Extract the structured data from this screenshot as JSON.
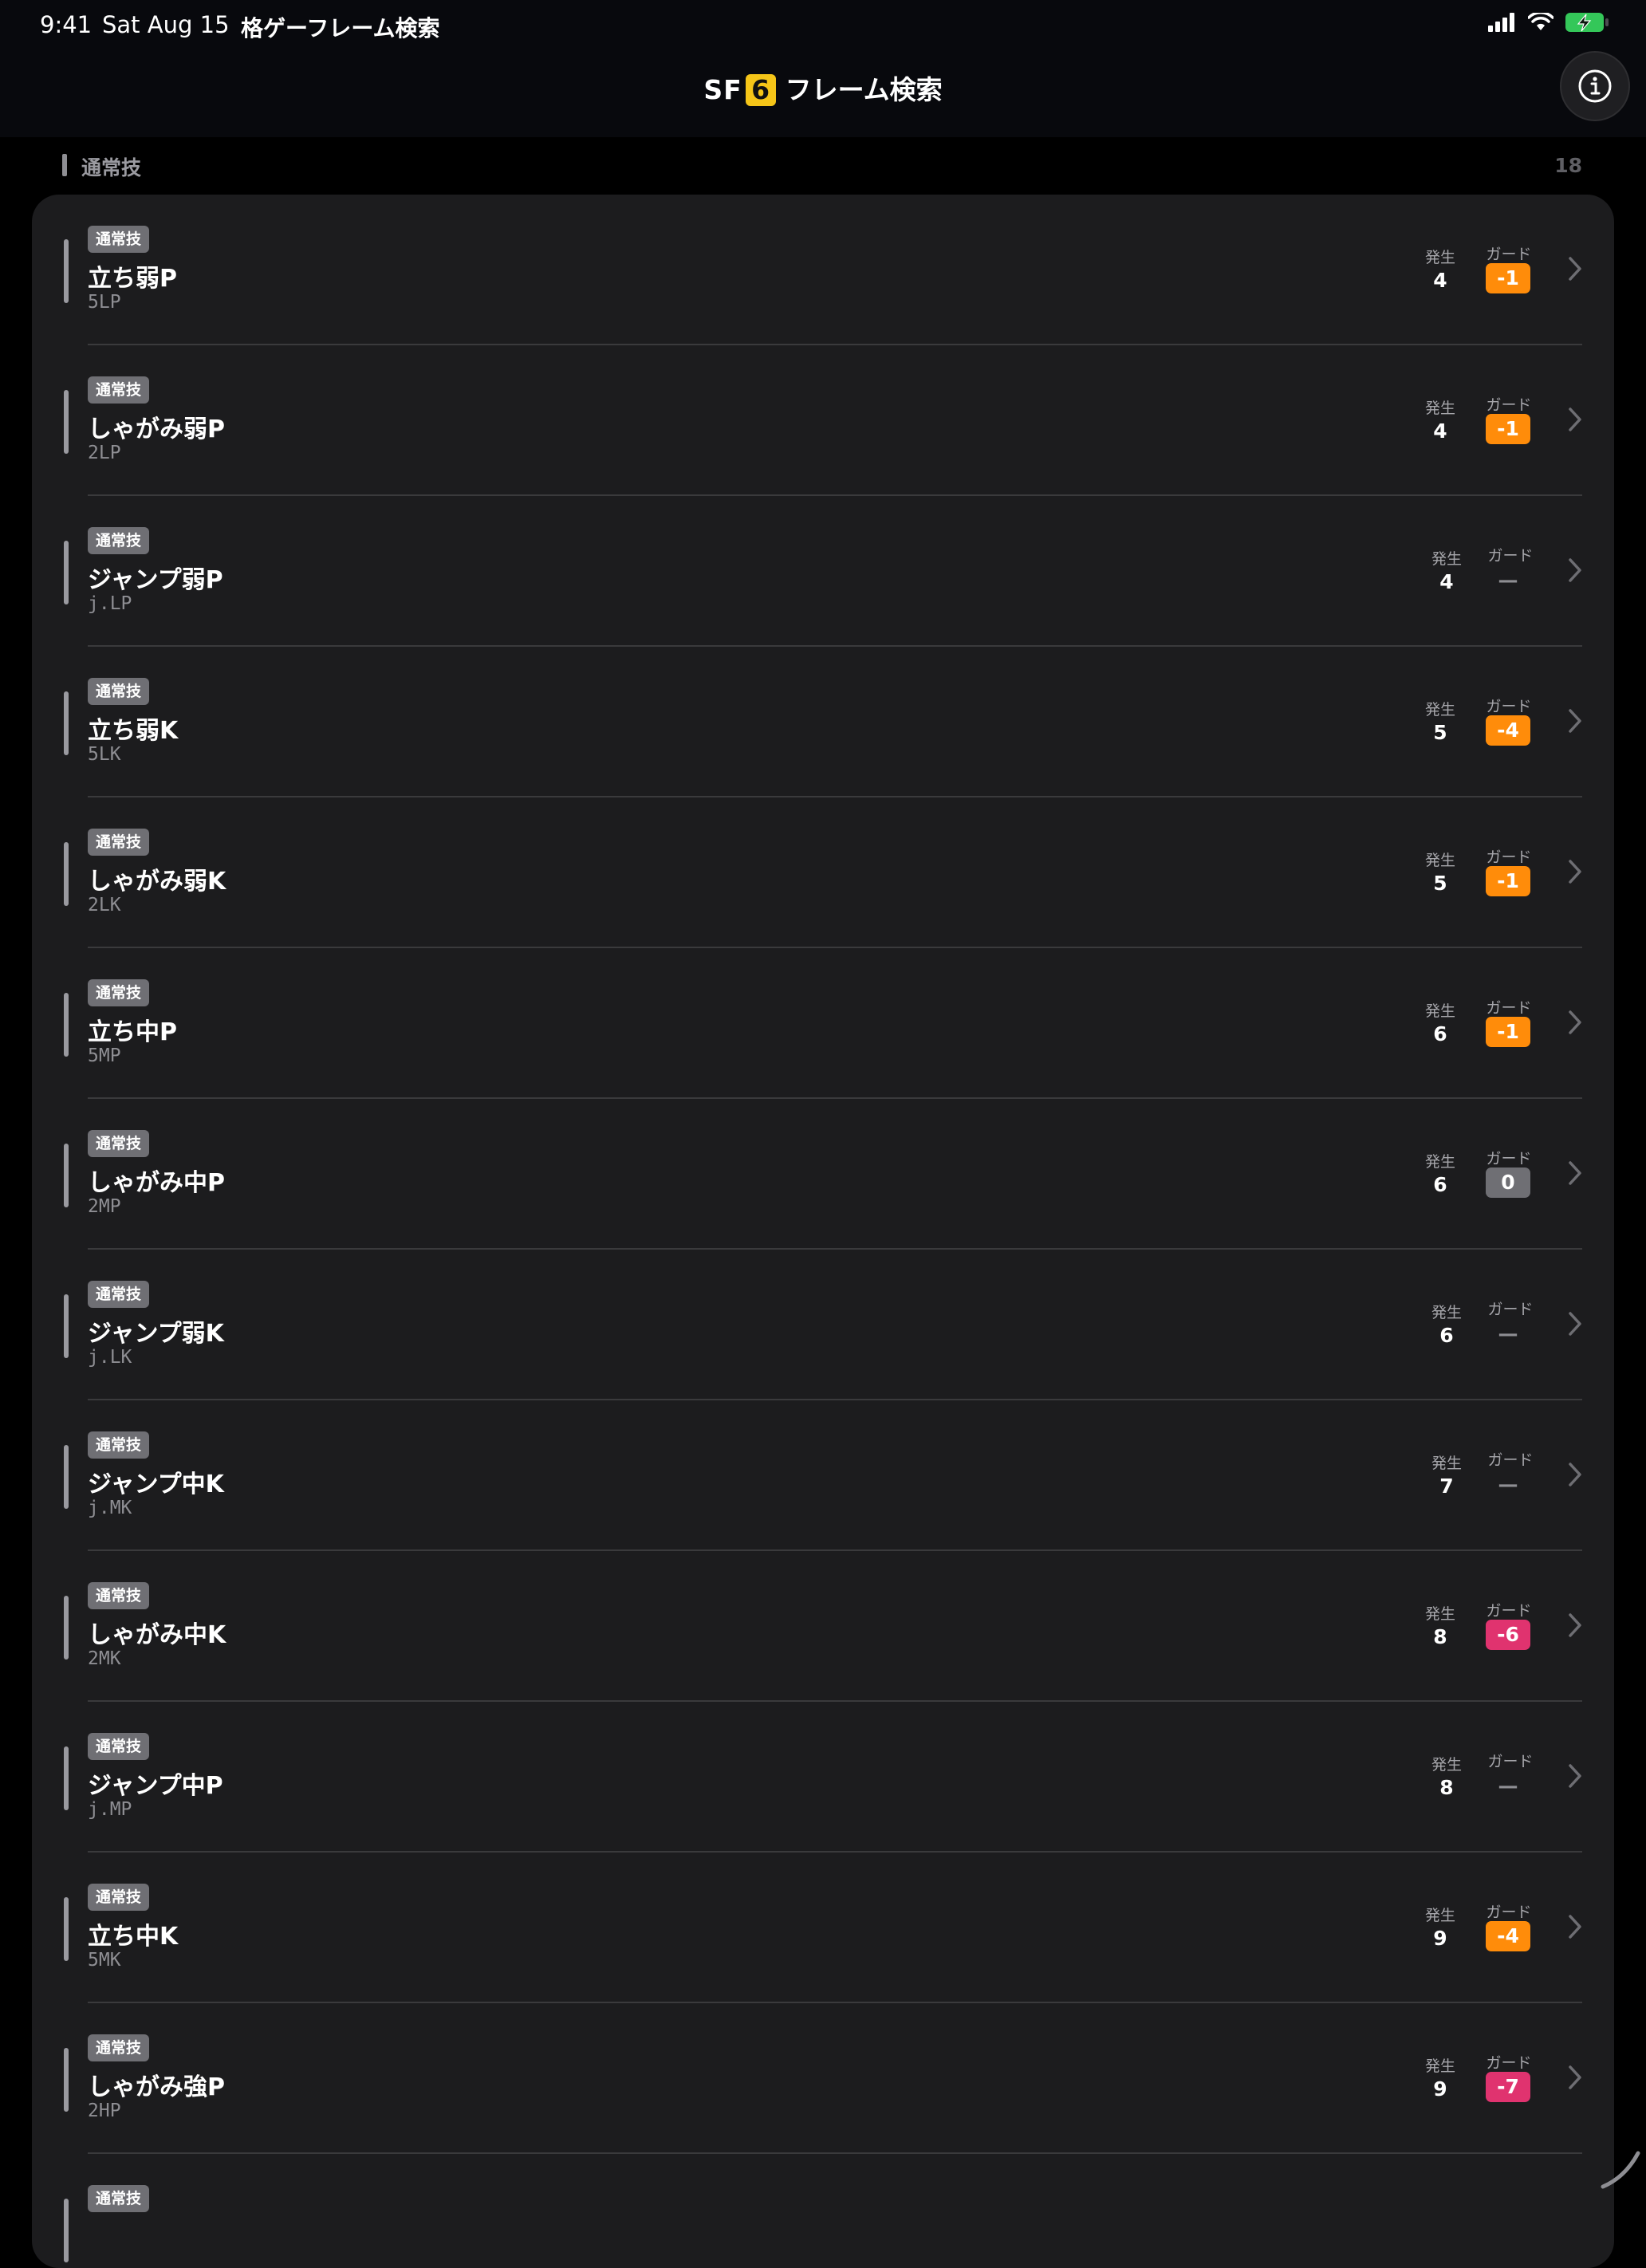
{
  "status_bar": {
    "time": "9:41",
    "date": "Sat Aug 15",
    "app": "格ゲーフレーム検索"
  },
  "nav": {
    "logo_sf": "SF",
    "logo_num": "6",
    "title": "フレーム検索"
  },
  "section": {
    "title": "通常技",
    "count": "18"
  },
  "labels": {
    "startup": "発生",
    "guard": "ガード"
  },
  "colors": {
    "orange": "#ff8c0a",
    "pink": "#e0336f",
    "gray": "#6f6f74",
    "battery": "#34c759"
  },
  "moves": [
    {
      "category": "通常技",
      "name": "立ち弱P",
      "notation": "5LP",
      "startup": "4",
      "guard": "-1",
      "guard_color": "orange"
    },
    {
      "category": "通常技",
      "name": "しゃがみ弱P",
      "notation": "2LP",
      "startup": "4",
      "guard": "-1",
      "guard_color": "orange"
    },
    {
      "category": "通常技",
      "name": "ジャンプ弱P",
      "notation": "j.LP",
      "startup": "4",
      "guard": "—",
      "guard_color": "none"
    },
    {
      "category": "通常技",
      "name": "立ち弱K",
      "notation": "5LK",
      "startup": "5",
      "guard": "-4",
      "guard_color": "orange"
    },
    {
      "category": "通常技",
      "name": "しゃがみ弱K",
      "notation": "2LK",
      "startup": "5",
      "guard": "-1",
      "guard_color": "orange"
    },
    {
      "category": "通常技",
      "name": "立ち中P",
      "notation": "5MP",
      "startup": "6",
      "guard": "-1",
      "guard_color": "orange"
    },
    {
      "category": "通常技",
      "name": "しゃがみ中P",
      "notation": "2MP",
      "startup": "6",
      "guard": "0",
      "guard_color": "gray"
    },
    {
      "category": "通常技",
      "name": "ジャンプ弱K",
      "notation": "j.LK",
      "startup": "6",
      "guard": "—",
      "guard_color": "none"
    },
    {
      "category": "通常技",
      "name": "ジャンプ中K",
      "notation": "j.MK",
      "startup": "7",
      "guard": "—",
      "guard_color": "none"
    },
    {
      "category": "通常技",
      "name": "しゃがみ中K",
      "notation": "2MK",
      "startup": "8",
      "guard": "-6",
      "guard_color": "pink"
    },
    {
      "category": "通常技",
      "name": "ジャンプ中P",
      "notation": "j.MP",
      "startup": "8",
      "guard": "—",
      "guard_color": "none"
    },
    {
      "category": "通常技",
      "name": "立ち中K",
      "notation": "5MK",
      "startup": "9",
      "guard": "-4",
      "guard_color": "orange"
    },
    {
      "category": "通常技",
      "name": "しゃがみ強P",
      "notation": "2HP",
      "startup": "9",
      "guard": "-7",
      "guard_color": "pink"
    },
    {
      "category": "通常技",
      "name": "",
      "notation": "",
      "startup": "",
      "guard": "",
      "guard_color": "none"
    }
  ]
}
